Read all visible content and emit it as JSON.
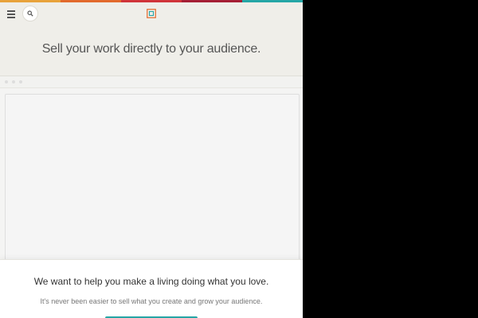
{
  "colors": {
    "page_background": "#efeee9",
    "outside_background": "#000000",
    "accent": "#25a6a6",
    "stripe": [
      "#e8a23b",
      "#e26a2c",
      "#d0343a",
      "#a51f35",
      "#25a6a6"
    ]
  },
  "topbar": {
    "menu_icon": "hamburger-menu-icon",
    "search_icon": "search-icon",
    "logo_icon": "gumroad-logo-icon"
  },
  "hero": {
    "title": "Sell your work directly to your audience."
  },
  "modal": {
    "heading": "We want to help you make a living doing what you love.",
    "subheading": "It's never been easier to sell what you create and grow your audience."
  }
}
